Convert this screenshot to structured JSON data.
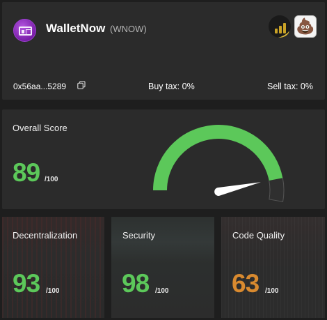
{
  "token": {
    "name": "WalletNow",
    "symbol": "(WNOW)",
    "address": "0x56aa...5289",
    "buy_tax": "Buy tax: 0%",
    "sell_tax": "Sell tax: 0%",
    "badge_2_glyph": "💩"
  },
  "overall": {
    "title": "Overall Score",
    "score": "89",
    "denominator": "/100",
    "score_value": 89,
    "max_value": 100,
    "gauge_color": "#5cc85a",
    "gauge_track_color": "#2f2f2f"
  },
  "subscores": [
    {
      "title": "Decentralization",
      "score": "93",
      "denominator": "/100",
      "color": "#5cc85a"
    },
    {
      "title": "Security",
      "score": "98",
      "denominator": "/100",
      "color": "#5cc85a"
    },
    {
      "title": "Code Quality",
      "score": "63",
      "denominator": "/100",
      "color": "#d98a2f"
    }
  ],
  "colors": {
    "background": "#1e1e1e",
    "card": "#2b2b2b",
    "good": "#5cc85a",
    "warn": "#d98a2f"
  }
}
